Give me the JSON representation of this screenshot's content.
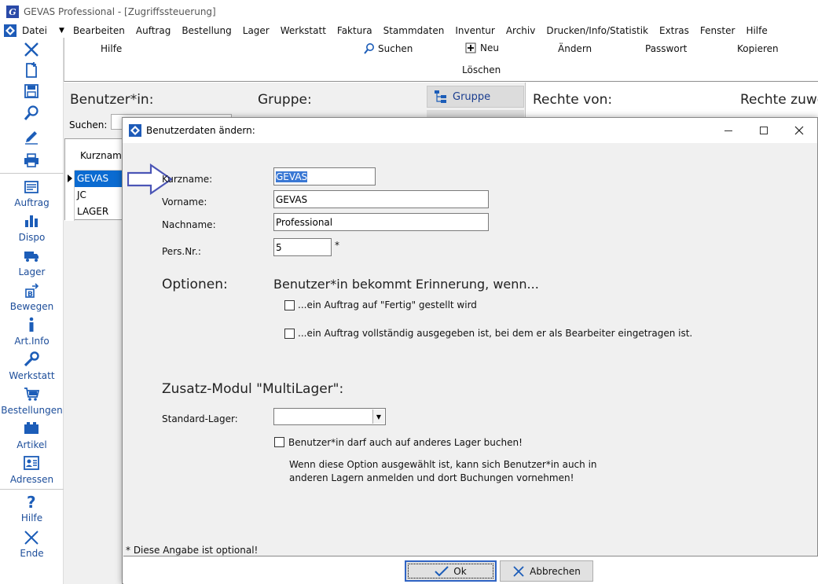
{
  "window": {
    "title": "GEVAS Professional - [Zugriffssteuerung]",
    "app_icon_letter": "G"
  },
  "menubar": {
    "items": [
      "Datei",
      "Bearbeiten",
      "Auftrag",
      "Bestellung",
      "Lager",
      "Werkstatt",
      "Faktura",
      "Stammdaten",
      "Inventur",
      "Archiv",
      "Drucken/Info/Statistik",
      "Extras",
      "Fenster",
      "Hilfe"
    ]
  },
  "sidebar": {
    "items": [
      {
        "label": "Auftrag",
        "icon": "auftrag-icon"
      },
      {
        "label": "Dispo",
        "icon": "dispo-icon"
      },
      {
        "label": "Lager",
        "icon": "lager-icon"
      },
      {
        "label": "Bewegen",
        "icon": "bewegen-icon"
      },
      {
        "label": "Art.Info",
        "icon": "info-icon"
      },
      {
        "label": "Werkstatt",
        "icon": "wrench-icon"
      },
      {
        "label": "Bestellungen",
        "icon": "cart-icon"
      },
      {
        "label": "Artikel",
        "icon": "artikel-icon"
      },
      {
        "label": "Adressen",
        "icon": "address-card-icon"
      },
      {
        "label": "Hilfe",
        "icon": "help-icon"
      },
      {
        "label": "Ende",
        "icon": "close-icon"
      }
    ]
  },
  "toolbar": {
    "hilfe": "Hilfe",
    "suchen": "Suchen",
    "neu": "Neu",
    "aendern": "Ändern",
    "passwort": "Passwort",
    "kopieren": "Kopieren",
    "loeschen": "Löschen"
  },
  "background": {
    "benutzer_head": "Benutzer*in:",
    "gruppe_head": "Gruppe:",
    "gruppe_btn": "Gruppe",
    "rechte_von": "Rechte von:",
    "rechte_zuwe": "Rechte zuwe",
    "suchen_label": "Suchen:",
    "list_header": "Kurzname",
    "users": [
      "GEVAS",
      "JC",
      "LAGER"
    ]
  },
  "dialog": {
    "title": "Benutzerdaten ändern:",
    "fields": {
      "kurzname_label": "Kurzname:",
      "kurzname_value": "GEVAS",
      "vorname_label": "Vorname:",
      "vorname_value": "GEVAS",
      "nachname_label": "Nachname:",
      "nachname_value": "Professional",
      "persnr_label": "Pers.Nr.:",
      "persnr_value": "5",
      "persnr_star": "*"
    },
    "optionen": {
      "heading": "Optionen:",
      "subheading": "Benutzer*in bekommt Erinnerung, wenn...",
      "option1": "...ein Auftrag auf \"Fertig\" gestellt wird",
      "option2": "...ein Auftrag vollständig ausgegeben ist, bei dem er als Bearbeiter eingetragen ist."
    },
    "multilager": {
      "heading": "Zusatz-Modul \"MultiLager\":",
      "standard_label": "Standard-Lager:",
      "standard_value": "",
      "option": "Benutzer*in darf auch auf anderes Lager buchen!",
      "info_line1": "Wenn diese Option ausgewählt ist, kann sich Benutzer*in auch in",
      "info_line2": "anderen Lagern anmelden und dort Buchungen vornehmen!"
    },
    "footnote": "* Diese Angabe ist optional!",
    "ok_label": "Ok",
    "cancel_label": "Abbrechen"
  },
  "colors": {
    "accent": "#1c5db8",
    "selection": "#0b6bd1",
    "arrow": "#4b55b6"
  }
}
